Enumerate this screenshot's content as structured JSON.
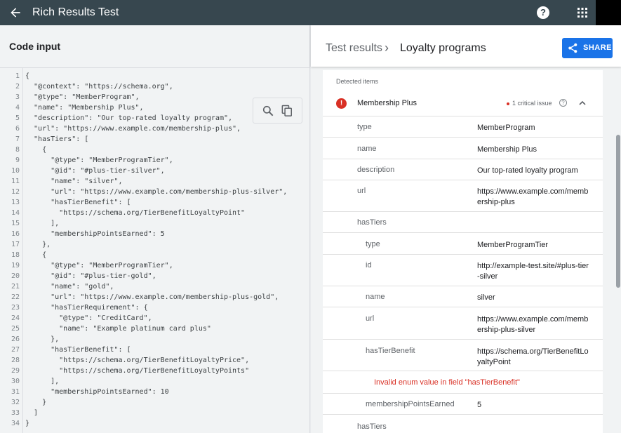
{
  "app": {
    "title": "Rich Results Test"
  },
  "code_panel": {
    "title": "Code input",
    "lines": [
      "{",
      "  \"@context\": \"https://schema.org\",",
      "  \"@type\": \"MemberProgram\",",
      "  \"name\": \"Membership Plus\",",
      "  \"description\": \"Our top-rated loyalty program\",",
      "  \"url\": \"https://www.example.com/membership-plus\",",
      "  \"hasTiers\": [",
      "    {",
      "      \"@type\": \"MemberProgramTier\",",
      "      \"@id\": \"#plus-tier-silver\",",
      "      \"name\": \"silver\",",
      "      \"url\": \"https://www.example.com/membership-plus-silver\",",
      "      \"hasTierBenefit\": [",
      "        \"https://schema.org/TierBenefitLoyaltyPoint\"",
      "      ],",
      "      \"membershipPointsEarned\": 5",
      "    },",
      "    {",
      "      \"@type\": \"MemberProgramTier\",",
      "      \"@id\": \"#plus-tier-gold\",",
      "      \"name\": \"gold\",",
      "      \"url\": \"https://www.example.com/membership-plus-gold\",",
      "      \"hasTierRequirement\": {",
      "        \"@type\": \"CreditCard\",",
      "        \"name\": \"Example platinum card plus\"",
      "      },",
      "      \"hasTierBenefit\": [",
      "        \"https://schema.org/TierBenefitLoyaltyPrice\",",
      "        \"https://schema.org/TierBenefitLoyaltyPoints\"",
      "      ],",
      "      \"membershipPointsEarned\": 10",
      "    }",
      "  ]",
      "}"
    ]
  },
  "results": {
    "breadcrumb": [
      "Test results",
      "Loyalty programs"
    ],
    "breadcrumb_sep": "›",
    "share_label": "SHARE",
    "detected_label": "Detected items",
    "item": {
      "name": "Membership Plus",
      "issue_label": "1 critical issue",
      "error_mark": "!",
      "help_mark": "?"
    },
    "properties": {
      "type": {
        "key": "type",
        "value": "MemberProgram"
      },
      "name": {
        "key": "name",
        "value": "Membership Plus"
      },
      "description": {
        "key": "description",
        "value": "Our top-rated loyalty program"
      },
      "url": {
        "key": "url",
        "value": "https://www.example.com/membership-plus"
      },
      "hasTiers": {
        "key": "hasTiers"
      }
    },
    "tier": {
      "type": {
        "key": "type",
        "value": "MemberProgramTier"
      },
      "id": {
        "key": "id",
        "value": "http://example-test.site/#plus-tier-silver"
      },
      "name": {
        "key": "name",
        "value": "silver"
      },
      "url": {
        "key": "url",
        "value": "https://www.example.com/membership-plus-silver"
      },
      "hasTierBenefit": {
        "key": "hasTierBenefit",
        "value": "https://schema.org/TierBenefitLoyaltyPoint"
      },
      "error": "Invalid enum value in field \"hasTierBenefit\"",
      "membershipPointsEarned": {
        "key": "membershipPointsEarned",
        "value": "5"
      }
    },
    "next_key": "hasTiers"
  },
  "help_glyph": "?",
  "colors": {
    "topbar": "#37474f",
    "accent": "#1a73e8",
    "error": "#d93025"
  }
}
